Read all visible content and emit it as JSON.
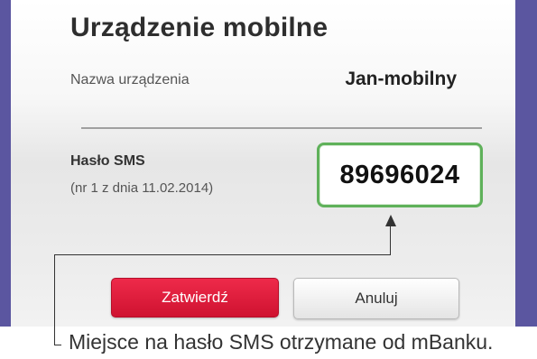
{
  "dialog": {
    "title": "Urządzenie mobilne",
    "device_name_label": "Nazwa urządzenia",
    "device_name_value": "Jan-mobilny",
    "sms_label": "Hasło SMS",
    "sms_sublabel": "(nr 1 z dnia 11.02.2014)",
    "sms_code": "89696024",
    "confirm_label": "Zatwierdź",
    "cancel_label": "Anuluj"
  },
  "annotation": {
    "caption": "Miejsce na hasło SMS otrzymane od mBanku."
  },
  "colors": {
    "background": "#5b56a0",
    "confirm_button": "#e31c3d",
    "code_border": "#5fb15a"
  }
}
